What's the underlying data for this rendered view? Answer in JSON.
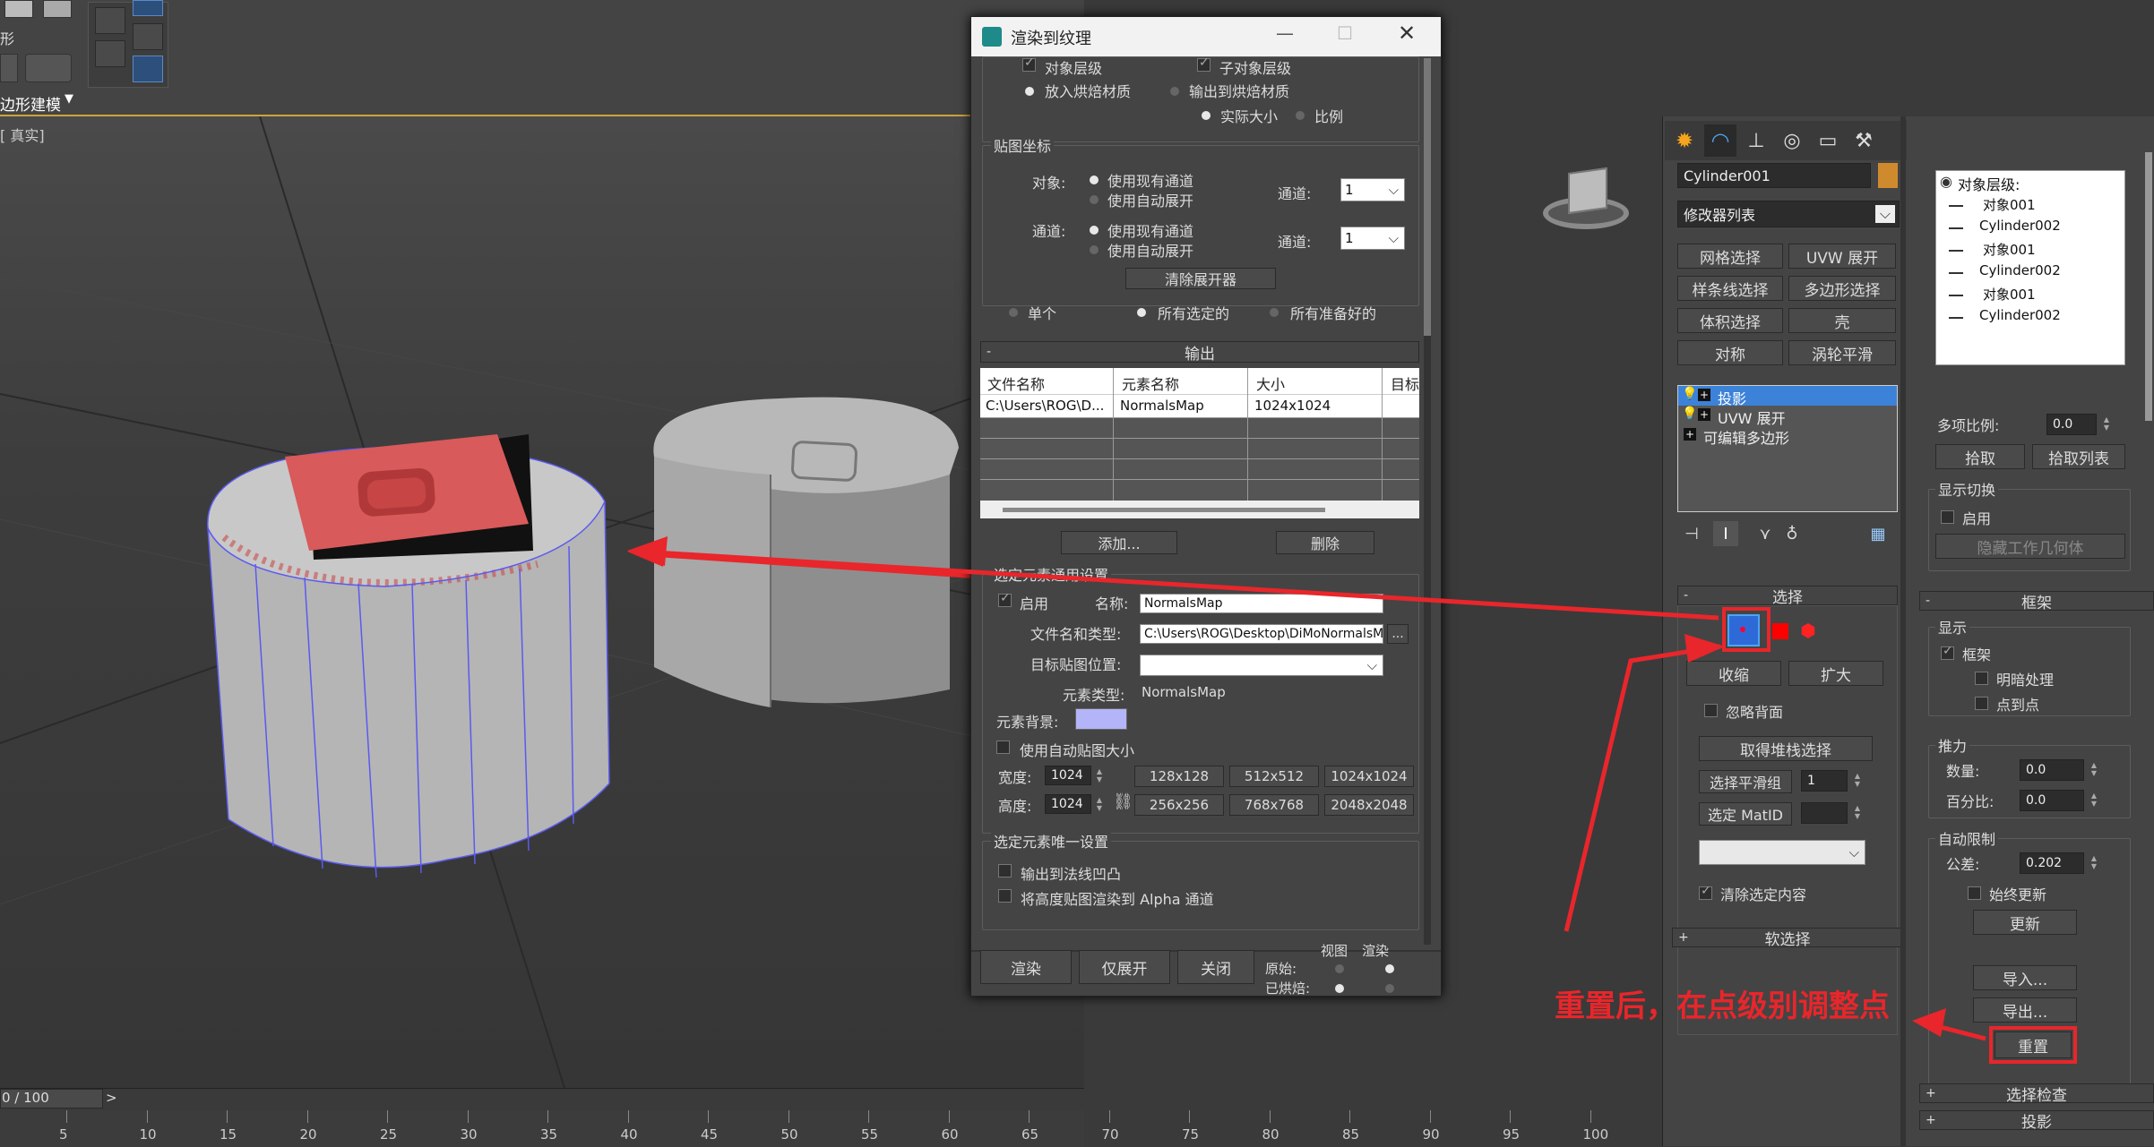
{
  "toolbar": {
    "mode_label": "边形建模",
    "mode_prefix": "形",
    "viewport_label": "[ 真实]"
  },
  "timeline": {
    "frame": "0 / 100",
    "next": ">",
    "ticks": [
      "5",
      "10",
      "15",
      "20",
      "25",
      "30",
      "35",
      "40",
      "45",
      "50",
      "55",
      "60",
      "65",
      "70",
      "75",
      "80",
      "85",
      "90",
      "95",
      "100"
    ]
  },
  "annotation": {
    "text": "重置后，在点级别调整点",
    "color": "#e8262b"
  },
  "dialog": {
    "title": "渲染到纹理",
    "top": {
      "obj_level": "对象层级",
      "sub_obj_level": "子对象层级",
      "put_bake_material": "放入烘焙材质",
      "output_bake_material": "输出到烘焙材质",
      "actual_size": "实际大小",
      "ratio": "比例"
    },
    "mapcoord": {
      "group_title": "贴图坐标",
      "obj_label": "对象:",
      "obj_opt1": "使用现有通道",
      "obj_opt2": "使用自动展开",
      "channel_label": "通道:",
      "channel_value1": "1",
      "sub_label": "通道:",
      "sub_opt1": "使用现有通道",
      "sub_opt2": "使用自动展开",
      "channel_value2": "1",
      "clear_unwrapper": "清除展开器"
    },
    "scope": {
      "single": "单个",
      "all_selected": "所有选定的",
      "all_prepared": "所有准备好的"
    },
    "output": {
      "rollout": "输出",
      "columns": [
        "文件名称",
        "元素名称",
        "大小",
        "目标"
      ],
      "row": [
        "C:\\Users\\ROG\\D...",
        "NormalsMap",
        "1024x1024",
        ""
      ],
      "add": "添加...",
      "delete": "删除"
    },
    "common": {
      "group_title": "选定元素通用设置",
      "enable": "启用",
      "name_label": "名称:",
      "name_value": "NormalsMap",
      "file_label": "文件名和类型:",
      "file_value": "C:\\Users\\ROG\\Desktop\\DiMoNormalsM",
      "browse": "...",
      "target_label": "目标贴图位置:",
      "type_label": "元素类型:",
      "type_value": "NormalsMap",
      "bg_label": "元素背景:",
      "bg_color": "#b4b4f8",
      "auto_size": "使用自动贴图大小",
      "width_label": "宽度:",
      "width_value": "1024",
      "height_label": "高度:",
      "height_value": "1024",
      "sizes": [
        "128x128",
        "512x512",
        "1024x1024",
        "256x256",
        "768x768",
        "2048x2048"
      ]
    },
    "unique": {
      "group_title": "选定元素唯一设置",
      "opt1": "输出到法线凹凸",
      "opt2": "将高度贴图渲染到 Alpha 通道"
    },
    "footer": {
      "render": "渲染",
      "unwrap_only": "仅展开",
      "close": "关闭",
      "view": "视图",
      "render_col": "渲染",
      "original": "原始:",
      "baked": "已烘焙:"
    }
  },
  "command_panel": {
    "object_name": "Cylinder001",
    "object_color": "#d08a2e",
    "modifier_list": "修改器列表",
    "buttons": [
      "网格选择",
      "UVW 展开",
      "样条线选择",
      "多边形选择",
      "体积选择",
      "壳",
      "对称",
      "涡轮平滑"
    ],
    "stack": [
      "投影",
      "UVW 展开",
      "可编辑多边形"
    ],
    "selection": {
      "rollout": "选择",
      "shrink": "收缩",
      "grow": "扩大",
      "ignore_back": "忽略背面",
      "get_stack_sel": "取得堆栈选择",
      "select_smooth": "选择平滑组",
      "smooth_value": "1",
      "select_matid": "选定 MatID",
      "clear_sel": "清除选定内容"
    },
    "soft_selection": "软选择"
  },
  "projection_panel": {
    "tree": [
      "对象层级:",
      "对象001",
      "Cylinder002",
      "对象001",
      "Cylinder002",
      "对象001",
      "Cylinder002"
    ],
    "multi_ratio_label": "多项比例:",
    "multi_ratio_value": "0.0",
    "pick": "拾取",
    "pick_list": "拾取列表",
    "display_toggle": "显示切换",
    "enable": "启用",
    "hide_cage": "隐藏工作几何体",
    "cage_rollout": "框架",
    "display": "显示",
    "cage": "框架",
    "shaded": "明暗处理",
    "points": "点到点",
    "push": "推力",
    "amount_label": "数量:",
    "amount_value": "0.0",
    "percent_label": "百分比:",
    "percent_value": "0.0",
    "auto_wrap": "自动限制",
    "tolerance_label": "公差:",
    "tolerance_value": "0.202",
    "always_update": "始终更新",
    "update": "更新",
    "import": "导入...",
    "export": "导出...",
    "reset": "重置",
    "select_check": "选择检查",
    "projection": "投影"
  }
}
